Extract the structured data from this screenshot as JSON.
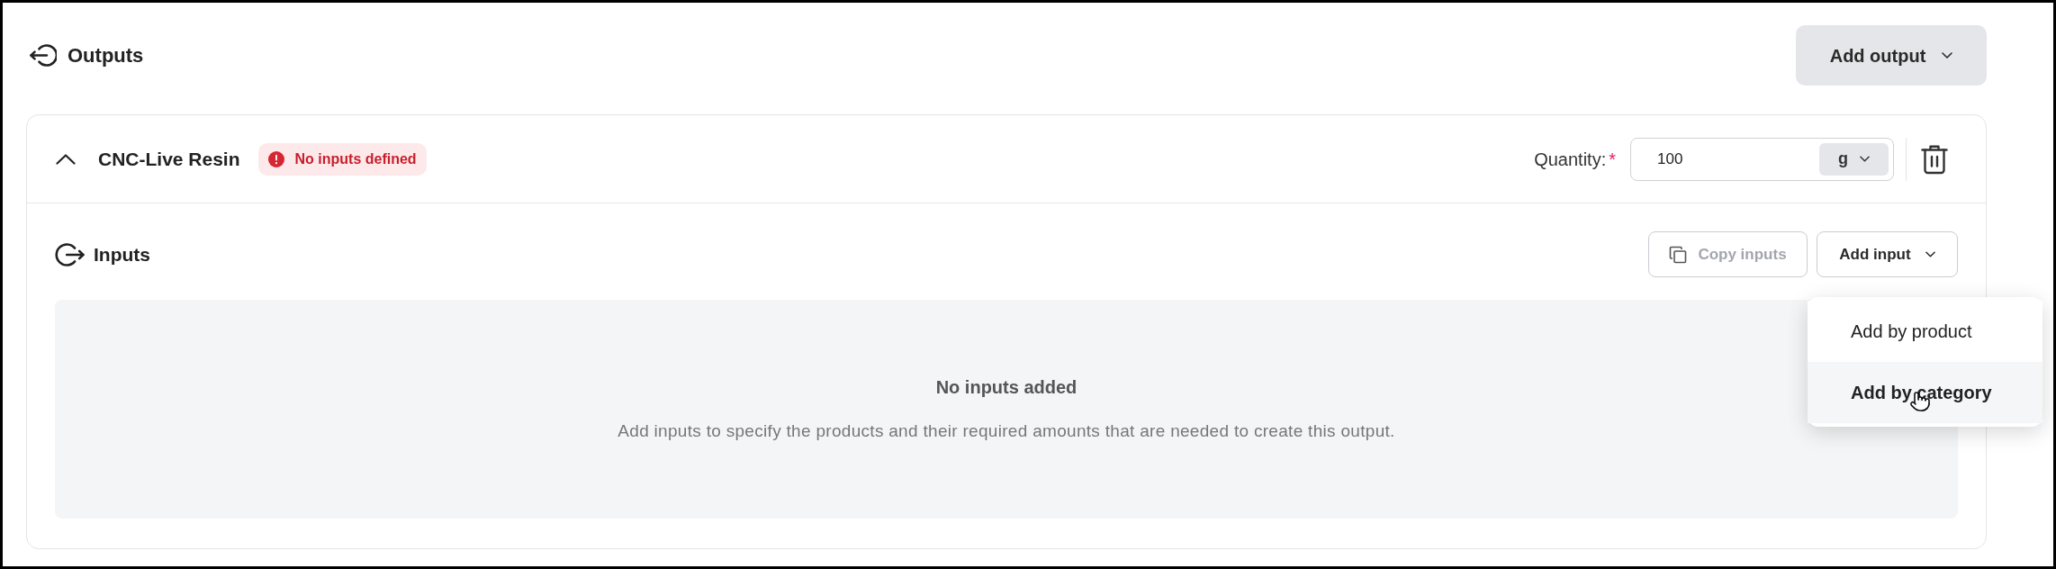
{
  "header": {
    "title": "Outputs",
    "add_button": {
      "label": "Add output"
    }
  },
  "outputs": [
    {
      "name": "CNC-Live Resin",
      "expanded": true,
      "badge": {
        "kind": "error",
        "label": "No inputs defined"
      },
      "quantity": {
        "label": "Quantity:",
        "required_mark": "*",
        "value": "100",
        "unit": "g"
      },
      "inputs": {
        "title": "Inputs",
        "buttons": [
          {
            "kind": "copy",
            "label": "Copy inputs",
            "disabled": true
          },
          {
            "kind": "dropdown",
            "label": "Add input",
            "disabled": false,
            "menu": {
              "items": [
                {
                  "label": "Add by product",
                  "selected": false
                },
                {
                  "label": "Add by category",
                  "selected": true
                }
              ]
            }
          }
        ],
        "empty_state": {
          "title": "No inputs added",
          "description": "Add inputs to specify the products and their required amounts that are needed to create this output."
        }
      }
    }
  ]
}
